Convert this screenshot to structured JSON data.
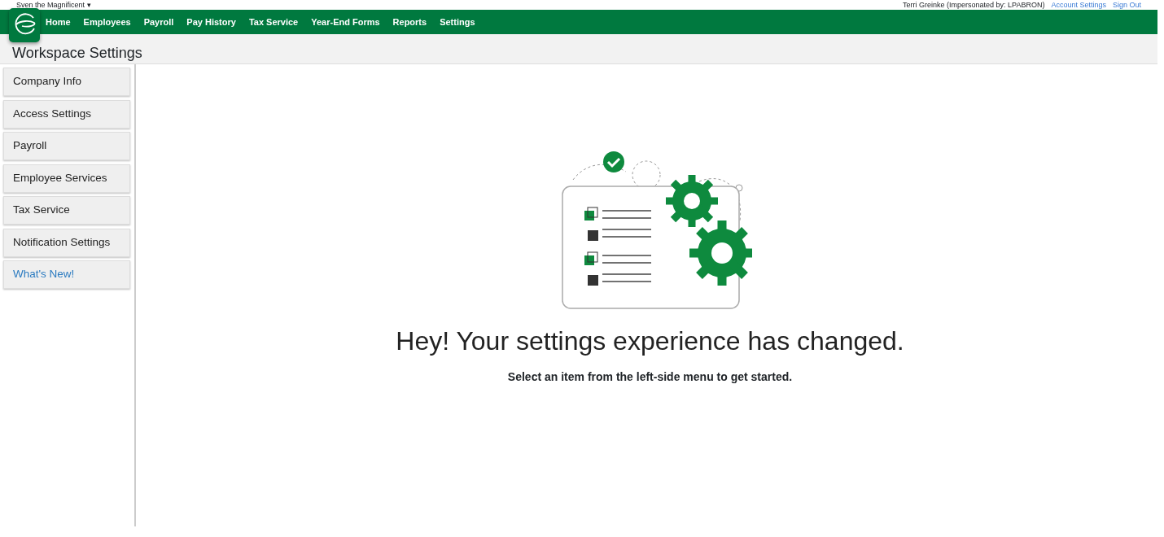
{
  "top_bar": {
    "company": "Sven the Magnificent",
    "company_caret": "▾",
    "user": "Terri Greinke (Impersonated by: LPABRON)",
    "links": [
      "Account Settings",
      "Sign Out"
    ]
  },
  "nav": {
    "items": [
      "Home",
      "Employees",
      "Payroll",
      "Pay History",
      "Tax Service",
      "Year-End Forms",
      "Reports",
      "Settings"
    ]
  },
  "page_title": "Workspace Settings",
  "sidebar": {
    "items": [
      {
        "label": "Company Info",
        "kind": "item"
      },
      {
        "label": "Access Settings",
        "kind": "item"
      },
      {
        "label": "Payroll",
        "kind": "item"
      },
      {
        "label": "Employee Services",
        "kind": "item"
      },
      {
        "label": "Tax Service",
        "kind": "item"
      },
      {
        "label": "Notification Settings",
        "kind": "item"
      },
      {
        "label": "What's New!",
        "kind": "link"
      }
    ]
  },
  "main": {
    "heading": "Hey! Your settings experience has changed.",
    "subtext": "Select an item from the left-side menu to get started."
  }
}
